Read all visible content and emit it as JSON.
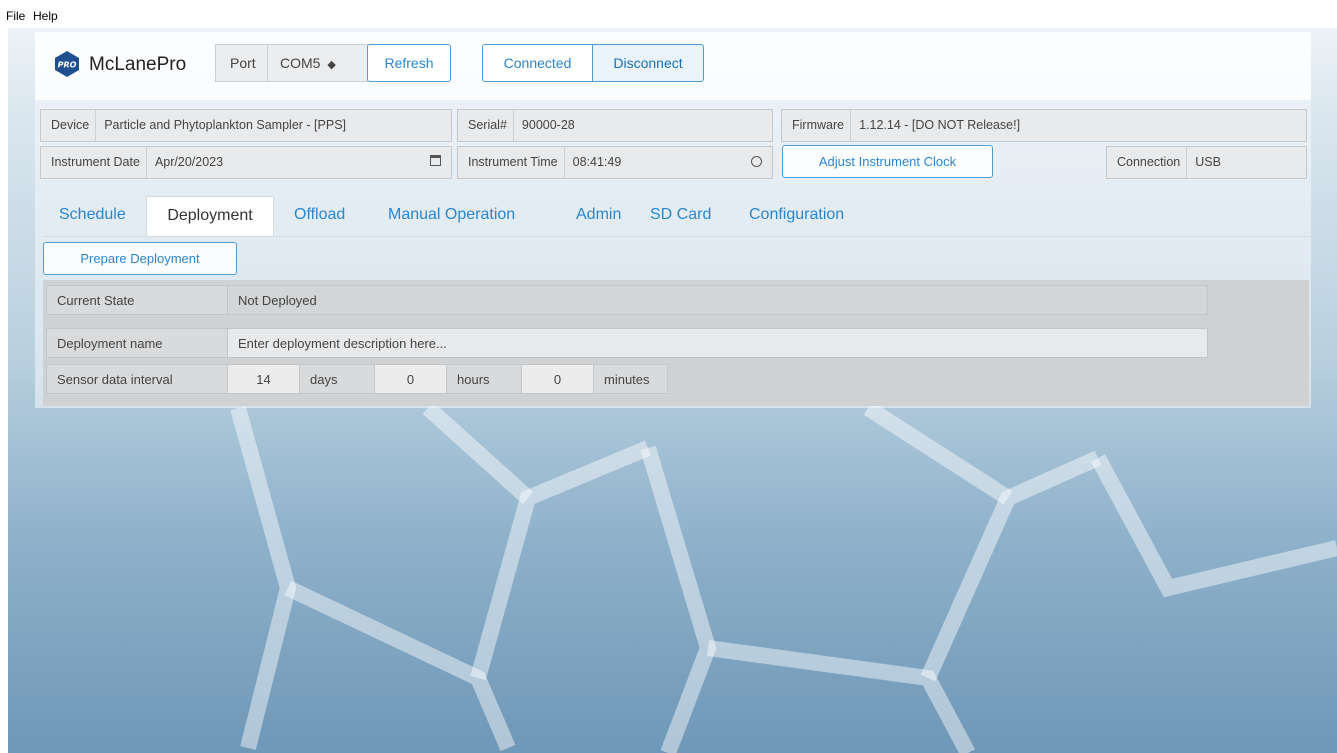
{
  "menu": {
    "file": "File",
    "help": "Help"
  },
  "brand": {
    "logo_text": "PRO",
    "name": "McLanePro"
  },
  "port": {
    "label": "Port",
    "value": "COM5",
    "refresh": "Refresh"
  },
  "connection_buttons": {
    "connected": "Connected",
    "disconnect": "Disconnect"
  },
  "info": {
    "device_label": "Device",
    "device_value": "Particle and Phytoplankton Sampler - [PPS]",
    "serial_label": "Serial#",
    "serial_value": "90000-28",
    "firmware_label": "Firmware",
    "firmware_value": "1.12.14 - [DO NOT Release!]",
    "date_label": "Instrument Date",
    "date_value": "Apr/20/2023",
    "time_label": "Instrument Time",
    "time_value": "08:41:49",
    "adjust_clock": "Adjust Instrument Clock",
    "conn_label": "Connection",
    "conn_value": "USB"
  },
  "tabs": [
    "Schedule",
    "Deployment",
    "Offload",
    "Manual Operation",
    "Admin",
    "SD Card",
    "Configuration"
  ],
  "active_tab": "Deployment",
  "deployment": {
    "prepare_button": "Prepare Deployment",
    "current_state_label": "Current State",
    "current_state_value": "Not Deployed",
    "name_label": "Deployment name",
    "name_placeholder": "Enter deployment description here...",
    "interval_label": "Sensor data interval",
    "days_value": "14",
    "days_unit": "days",
    "hours_value": "0",
    "hours_unit": "hours",
    "minutes_value": "0",
    "minutes_unit": "minutes"
  },
  "colors": {
    "accent": "#2b86d0",
    "accent_border": "#4e9bd8"
  },
  "icons": {
    "date_picker": "calendar-icon",
    "time_picker": "clock-icon",
    "select": "sort-arrows-icon"
  }
}
